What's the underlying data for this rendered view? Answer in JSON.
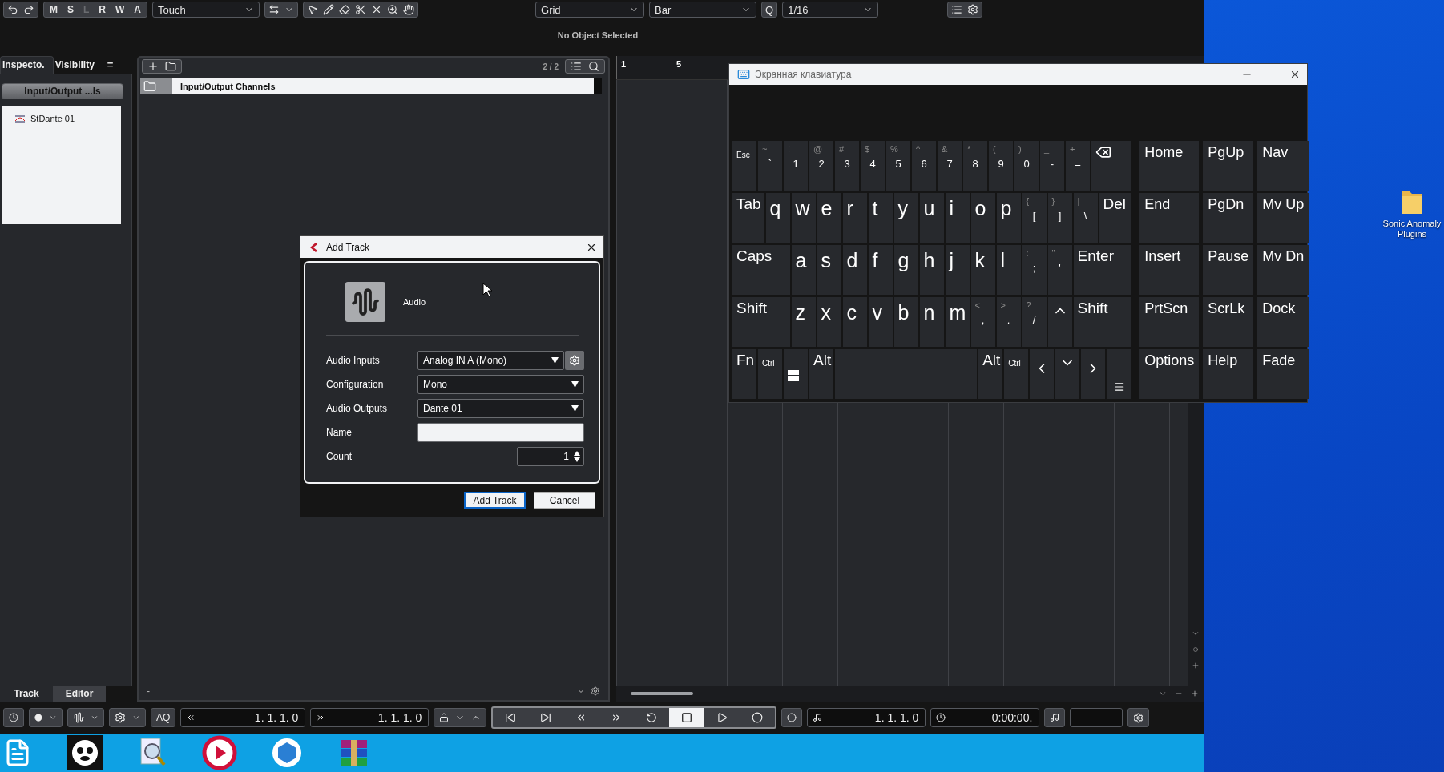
{
  "toolbar": {
    "mode_buttons": [
      {
        "label": "M",
        "disabled": false
      },
      {
        "label": "S",
        "disabled": false
      },
      {
        "label": "L",
        "disabled": true
      },
      {
        "label": "R",
        "disabled": false
      },
      {
        "label": "W",
        "disabled": false
      },
      {
        "label": "A",
        "disabled": false
      }
    ],
    "automation_mode": "Touch",
    "snap_type": "Grid",
    "grid_type": "Bar",
    "quantize_label": "Q",
    "quantize": "1/16"
  },
  "info_line": "No Object Selected",
  "left_zone": {
    "tabs": [
      {
        "label": "Inspecto.",
        "selected": true
      },
      {
        "label": "Visibility",
        "selected": false
      }
    ],
    "menu_glyph": "=",
    "folder_button": "Input/Output ...ls",
    "tree": [
      {
        "label": "StDante 01"
      }
    ],
    "bottom_tabs": [
      {
        "label": "Track",
        "selected": true
      },
      {
        "label": "Editor",
        "selected": false
      }
    ]
  },
  "track_list": {
    "counter": "2 / 2",
    "rows": [
      {
        "name": "Input/Output Channels"
      }
    ],
    "zoom_minus": "-"
  },
  "ruler": {
    "marks": [
      "1",
      "5"
    ]
  },
  "transport": {
    "aq": "AQ",
    "left_locator": "1. 1. 1. 0",
    "right_locator": "1. 1. 1. 0",
    "position": "1. 1. 1. 0",
    "time": "0:00:00."
  },
  "add_track_dialog": {
    "title": "Add Track",
    "track_type": "Audio",
    "fields": [
      {
        "label": "Audio Inputs",
        "kind": "select",
        "value": "Analog IN A (Mono)",
        "settings_button": true
      },
      {
        "label": "Configuration",
        "kind": "select",
        "value": "Mono",
        "settings_button": false
      },
      {
        "label": "Audio Outputs",
        "kind": "select",
        "value": "Dante 01",
        "settings_button": false
      },
      {
        "label": "Name",
        "kind": "text",
        "settings_button": false
      },
      {
        "label": "Count",
        "kind": "spin",
        "value": "1",
        "settings_button": false
      }
    ],
    "buttons": [
      {
        "label": "Add Track",
        "default": true
      },
      {
        "label": "Cancel",
        "default": false
      }
    ]
  },
  "keyboard_window": {
    "title": "Экранная клавиатура",
    "rows": [
      [
        {
          "kind": "small",
          "label": "Esc",
          "wide": false
        },
        {
          "kind": "symbol",
          "shift": "~",
          "label": "`",
          "wide": false
        },
        {
          "kind": "symbol",
          "shift": "!",
          "label": "1",
          "wide": false
        },
        {
          "kind": "symbol",
          "shift": "@",
          "label": "2",
          "wide": false
        },
        {
          "kind": "symbol",
          "shift": "#",
          "label": "3",
          "wide": false
        },
        {
          "kind": "symbol",
          "shift": "$",
          "label": "4",
          "wide": false
        },
        {
          "kind": "symbol",
          "shift": "%",
          "label": "5",
          "wide": false
        },
        {
          "kind": "symbol",
          "shift": "^",
          "label": "6",
          "wide": false
        },
        {
          "kind": "symbol",
          "shift": "&",
          "label": "7",
          "wide": false
        },
        {
          "kind": "symbol",
          "shift": "*",
          "label": "8",
          "wide": false
        },
        {
          "kind": "symbol",
          "shift": "(",
          "label": "9",
          "wide": false
        },
        {
          "kind": "symbol",
          "shift": ")",
          "label": "0",
          "wide": false
        },
        {
          "kind": "symbol",
          "shift": "_",
          "label": "-",
          "wide": false
        },
        {
          "kind": "symbol",
          "shift": "+",
          "label": "=",
          "wide": false
        },
        {
          "kind": "backspace",
          "wide": true
        }
      ],
      [
        {
          "kind": "label",
          "label": "Tab",
          "wide": true
        },
        {
          "kind": "letter",
          "label": "q",
          "wide": false
        },
        {
          "kind": "letter",
          "label": "w",
          "wide": false
        },
        {
          "kind": "letter",
          "label": "e",
          "wide": false
        },
        {
          "kind": "letter",
          "label": "r",
          "wide": false
        },
        {
          "kind": "letter",
          "label": "t",
          "wide": false
        },
        {
          "kind": "letter",
          "label": "y",
          "wide": false
        },
        {
          "kind": "letter",
          "label": "u",
          "wide": false
        },
        {
          "kind": "letter",
          "label": "i",
          "wide": false
        },
        {
          "kind": "letter",
          "label": "o",
          "wide": false
        },
        {
          "kind": "letter",
          "label": "p",
          "wide": false
        },
        {
          "kind": "symbol",
          "shift": "{",
          "label": "[",
          "wide": false
        },
        {
          "kind": "symbol",
          "shift": "}",
          "label": "]",
          "wide": false
        },
        {
          "kind": "symbol",
          "shift": "|",
          "label": "\\",
          "wide": false
        },
        {
          "kind": "label",
          "label": "Del",
          "wide": true
        }
      ],
      [
        {
          "kind": "label",
          "label": "Caps",
          "wide": true
        },
        {
          "kind": "letter",
          "label": "a",
          "wide": false
        },
        {
          "kind": "letter",
          "label": "s",
          "wide": false
        },
        {
          "kind": "letter",
          "label": "d",
          "wide": false
        },
        {
          "kind": "letter",
          "label": "f",
          "wide": false
        },
        {
          "kind": "letter",
          "label": "g",
          "wide": false
        },
        {
          "kind": "letter",
          "label": "h",
          "wide": false
        },
        {
          "kind": "letter",
          "label": "j",
          "wide": false
        },
        {
          "kind": "letter",
          "label": "k",
          "wide": false
        },
        {
          "kind": "letter",
          "label": "l",
          "wide": false
        },
        {
          "kind": "symbol",
          "shift": ":",
          "label": ";",
          "wide": false
        },
        {
          "kind": "symbol",
          "shift": "\"",
          "label": "'",
          "wide": false
        },
        {
          "kind": "label",
          "label": "Enter",
          "wide": true
        }
      ],
      [
        {
          "kind": "label",
          "label": "Shift",
          "wide": true
        },
        {
          "kind": "letter",
          "label": "z",
          "wide": false
        },
        {
          "kind": "letter",
          "label": "x",
          "wide": false
        },
        {
          "kind": "letter",
          "label": "c",
          "wide": false
        },
        {
          "kind": "letter",
          "label": "v",
          "wide": false
        },
        {
          "kind": "letter",
          "label": "b",
          "wide": false
        },
        {
          "kind": "letter",
          "label": "n",
          "wide": false
        },
        {
          "kind": "letter",
          "label": "m",
          "wide": false
        },
        {
          "kind": "symbol",
          "shift": "<",
          "label": ",",
          "wide": false
        },
        {
          "kind": "symbol",
          "shift": ">",
          "label": ".",
          "wide": false
        },
        {
          "kind": "symbol",
          "shift": "?",
          "label": "/",
          "wide": false
        },
        {
          "kind": "arrow-up",
          "wide": false
        },
        {
          "kind": "label",
          "label": "Shift",
          "wide": true
        }
      ],
      [
        {
          "kind": "label",
          "label": "Fn",
          "wide": false
        },
        {
          "kind": "small",
          "label": "Ctrl",
          "wide": false
        },
        {
          "kind": "windows",
          "wide": false
        },
        {
          "kind": "label",
          "label": "Alt",
          "wide": false
        },
        {
          "kind": "space",
          "wide": true
        },
        {
          "kind": "label",
          "label": "Alt",
          "wide": false
        },
        {
          "kind": "small",
          "label": "Ctrl",
          "wide": false
        },
        {
          "kind": "arrow-left",
          "wide": false
        },
        {
          "kind": "arrow-down",
          "wide": false
        },
        {
          "kind": "arrow-right",
          "wide": false
        },
        {
          "kind": "menu",
          "wide": false
        }
      ]
    ],
    "nav_keys": [
      [
        "Home",
        "PgUp",
        "Nav"
      ],
      [
        "End",
        "PgDn",
        "Mv Up"
      ],
      [
        "Insert",
        "Pause",
        "Mv Dn"
      ],
      [
        "PrtScn",
        "ScrLk",
        "Dock"
      ],
      [
        "Options",
        "Help",
        "Fade"
      ]
    ]
  },
  "desktop_icons": [
    {
      "label": "Sonic Anomaly Plugins"
    }
  ]
}
